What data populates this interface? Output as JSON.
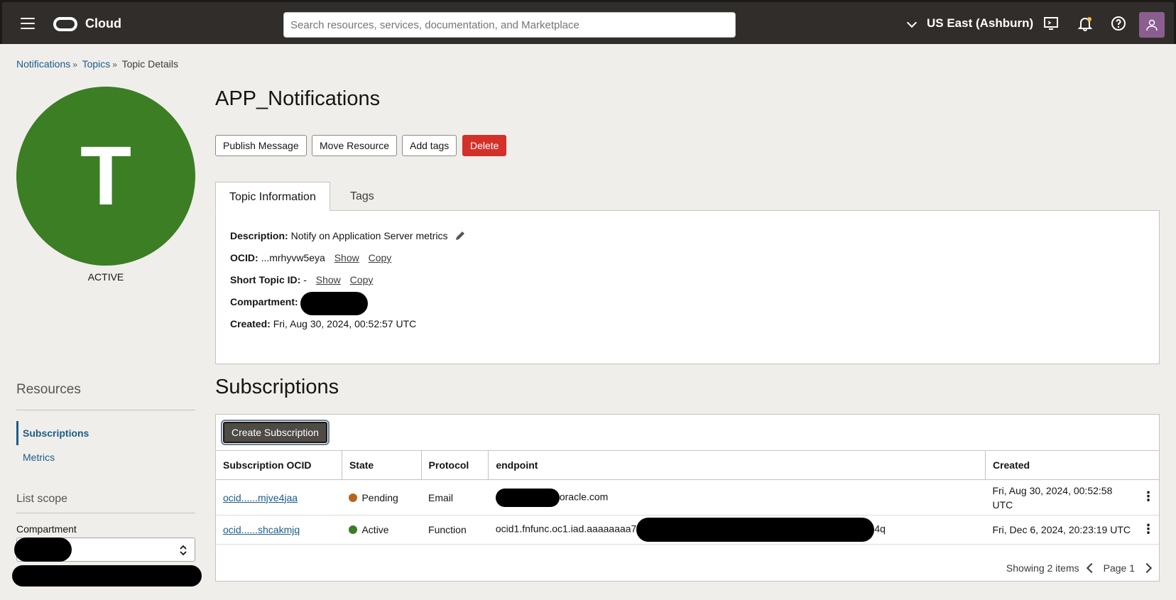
{
  "topbar": {
    "brand": "Cloud",
    "search_placeholder": "Search resources, services, documentation, and Marketplace",
    "region": "US East (Ashburn)"
  },
  "breadcrumb": {
    "items": [
      "Notifications",
      "Topics",
      "Topic Details"
    ]
  },
  "topic": {
    "avatar_letter": "T",
    "state": "ACTIVE",
    "title": "APP_Notifications"
  },
  "actions": {
    "publish": "Publish Message",
    "move": "Move Resource",
    "tags": "Add tags",
    "delete": "Delete"
  },
  "tabs": [
    "Topic Information",
    "Tags"
  ],
  "info": {
    "description_label": "Description:",
    "description_value": "Notify on Application Server metrics",
    "ocid_label": "OCID:",
    "ocid_value": "...mrhyvw5eya",
    "short_id_label": "Short Topic ID:",
    "short_id_value": "-",
    "show": "Show",
    "copy": "Copy",
    "compartment_label": "Compartment:",
    "created_label": "Created:",
    "created_value": "Fri, Aug 30, 2024, 00:52:57 UTC"
  },
  "resources": {
    "title": "Resources",
    "items": [
      "Subscriptions",
      "Metrics"
    ],
    "list_scope": "List scope",
    "compartment_label": "Compartment"
  },
  "subscriptions": {
    "title": "Subscriptions",
    "create_button": "Create Subscription",
    "columns": [
      "Subscription OCID",
      "State",
      "Protocol",
      "endpoint",
      "Created"
    ],
    "rows": [
      {
        "ocid": "ocid......mjve4jaa",
        "state": "Pending",
        "state_color": "#b5651d",
        "protocol": "Email",
        "endpoint": "oracle.com",
        "created": "Fri, Aug 30, 2024, 00:52:58 UTC"
      },
      {
        "ocid": "ocid......shcakmjq",
        "state": "Active",
        "state_color": "#3b7e24",
        "protocol": "Function",
        "endpoint_prefix": "ocid1.fnfunc.oc1.iad.aaaaaaaa7",
        "endpoint_suffix": "4q",
        "created": "Fri, Dec 6, 2024, 20:23:19 UTC"
      }
    ],
    "showing": "Showing 2 items",
    "page": "Page 1"
  }
}
